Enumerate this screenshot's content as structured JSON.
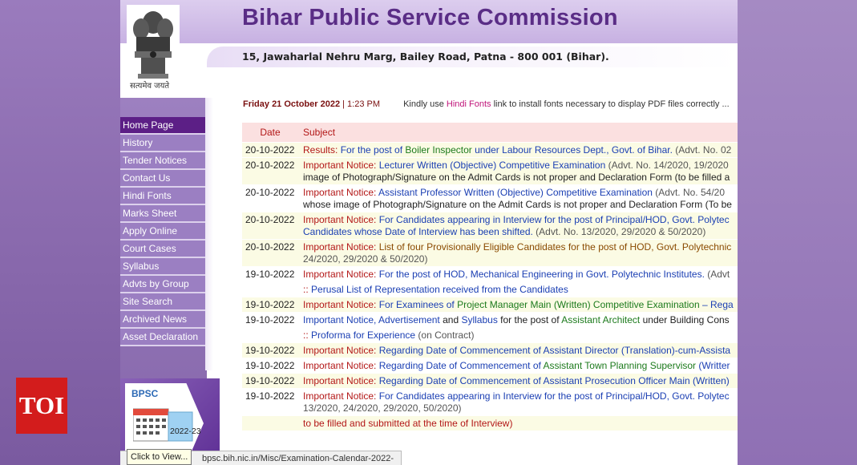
{
  "header": {
    "title": "Bihar Public Service Commission",
    "address": "15, Jawaharlal Nehru Marg, Bailey Road, Patna - 800 001 (Bihar).",
    "emblem_motto": "सत्यमेव जयते"
  },
  "dateline": {
    "date": "Friday 21 October 2022",
    "separator": "|",
    "time": "1:23 PM",
    "hint_prefix": "Kindly use ",
    "hint_link": "Hindi Fonts",
    "hint_suffix": " link to install fonts necessary to display PDF files correctly ..."
  },
  "nav": {
    "items": [
      "Home Page",
      "History",
      "Tender Notices",
      "Contact Us",
      "Hindi Fonts",
      "Marks Sheet",
      "Apply Online",
      "Court Cases",
      "Syllabus",
      "Advts by Group",
      "Site Search",
      "Archived News",
      "Asset Declaration"
    ]
  },
  "bpsc_banner": {
    "label": "BPSC",
    "year": "2022-23"
  },
  "table": {
    "headers": {
      "date": "Date",
      "subject": "Subject"
    },
    "rows": [
      {
        "date": "20-10-2022",
        "l1a": "Results: ",
        "l1b": "For the post of ",
        "l1c": "Boiler Inspector",
        "l1d": " under Labour Resources Dept., Govt. of Bihar.",
        "l1e": " (Advt. No. 02"
      },
      {
        "date": "20-10-2022",
        "l1a": "Important Notice: ",
        "l1b": "Lecturer Written (Objective) Competitive Examination",
        "l1e": " (Advt. No. 14/2020, 19/2020",
        "l2": "image of Photograph/Signature on the Admit Cards is not proper and Declaration Form (to be filled a"
      },
      {
        "date": "20-10-2022",
        "l1a": "Important Notice: ",
        "l1b": "Assistant Professor Written (Objective) Competitive Examination",
        "l1e": " (Advt. No. 54/20",
        "l2": "whose image of Photograph/Signature on the Admit Cards is not proper and Declaration Form (To be"
      },
      {
        "date": "20-10-2022",
        "l1a": "Important Notice: ",
        "l1b": "For Candidates appearing in Interview for the post of Principal/HOD, Govt. Polytec",
        "l2": "Candidates whose Date of Interview has been shifted.",
        "l2e": " (Advt. No. 13/2020, 29/2020 & 50/2020)"
      },
      {
        "date": "20-10-2022",
        "l1a": "Important Notice: ",
        "l1b": "List of four Provisionally Eligible Candidates for the post of HOD, Govt. Polytechnic",
        "l2e": "24/2020, 29/2020 & 50/2020)"
      },
      {
        "date": "19-10-2022",
        "l1a": "Important Notice: ",
        "l1b": "For the post of HOD, Mechanical Engineering in Govt. Polytechnic Institutes.",
        "l1e": " (Advt"
      },
      {
        "date": "",
        "l1a": ":: ",
        "l1b": "Perusal List of Representation received from the Candidates"
      },
      {
        "date": "19-10-2022",
        "l1a": "Important Notice: ",
        "l1b": "For Examinees of ",
        "l1c": "Project Manager Main (Written) Competitive Examination",
        "l1d": " – Rega"
      },
      {
        "date": "19-10-2022",
        "l1a": "Important Notice",
        "l1b": ", Advertisement",
        "l1f": " and ",
        "l1c": "Syllabus",
        "l1g": " for the post of ",
        "l1h": "Assistant Architect",
        "l1i": " under Building Cons"
      },
      {
        "date": "",
        "l1a": ":: ",
        "l1b": "Proforma for Experience",
        "l1e": " (on Contract)"
      },
      {
        "date": "19-10-2022",
        "l1a": "Important Notice: ",
        "l1b": "Regarding Date of Commencement of Assistant Director (Translation)-cum-Assista"
      },
      {
        "date": "19-10-2022",
        "l1a": "Important Notice: ",
        "l1b": "Regarding Date of Commencement of ",
        "l1c": "Assistant Town Planning Supervisor",
        "l1d": " (Writter"
      },
      {
        "date": "19-10-2022",
        "l1a": "Important Notice: ",
        "l1b": "Regarding Date of Commencement of Assistant Prosecution Officer Main (Written)"
      },
      {
        "date": "19-10-2022",
        "l1a": "Important Notice: ",
        "l1b": "For Candidates appearing in Interview for the post of Principal/HOD, Govt. Polytec",
        "l2e": "13/2020, 24/2020, 29/2020, 50/2020)"
      },
      {
        "date": "",
        "l1b": "to be filled and submitted at the time of Interview)"
      }
    ]
  },
  "status_bar": {
    "url": "bpsc.bih.nic.in/Misc/Examination-Calendar-2022-23.pdf",
    "tooltip": "Click to View..."
  },
  "watermark": {
    "text": "TOI"
  }
}
